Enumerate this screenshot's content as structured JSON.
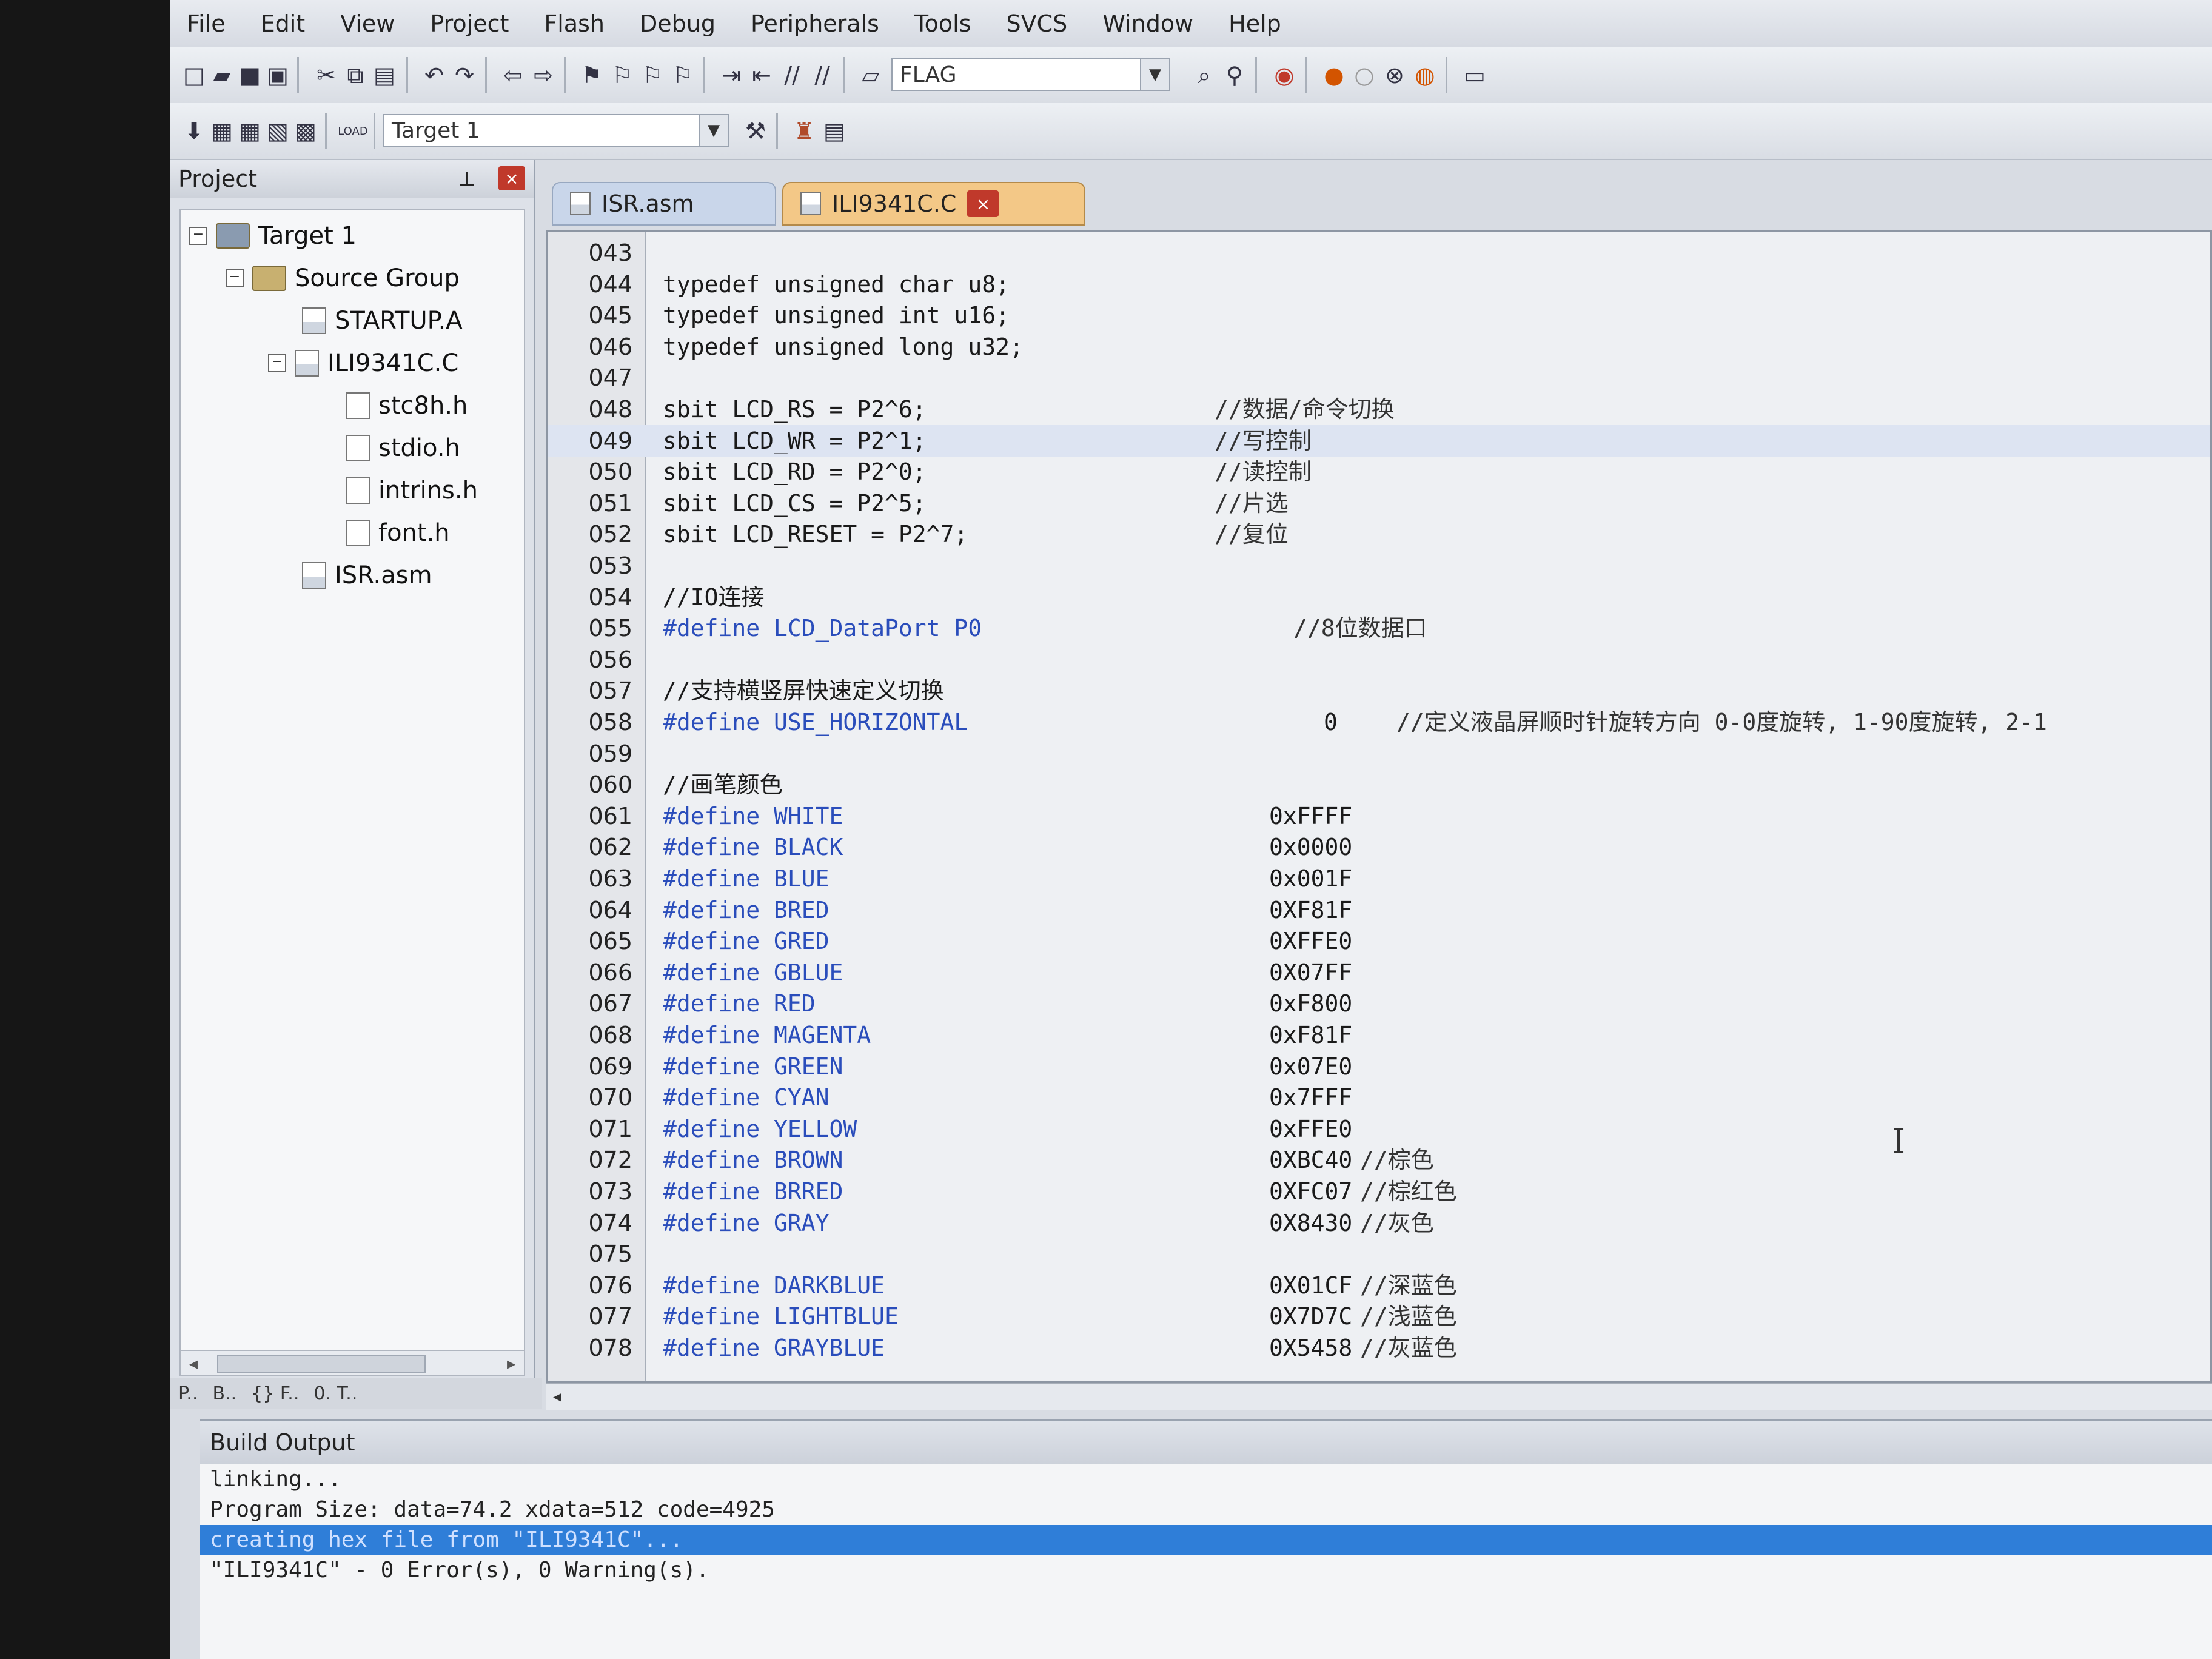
{
  "menu": [
    "File",
    "Edit",
    "View",
    "Project",
    "Flash",
    "Debug",
    "Peripherals",
    "Tools",
    "SVCS",
    "Window",
    "Help"
  ],
  "toolbar": {
    "flag_combo": "FLAG",
    "target_combo": "Target 1",
    "load_label": "LOAD"
  },
  "project": {
    "title": "Project",
    "target": "Target 1",
    "group": "Source Group",
    "files": [
      "STARTUP.A",
      "ILI9341C.C",
      "stc8h.h",
      "stdio.h",
      "intrins.h",
      "font.h",
      "ISR.asm"
    ],
    "tabs": [
      "P..",
      "B..",
      "{} F..",
      "0. T.."
    ]
  },
  "editor": {
    "tabs": [
      "ISR.asm",
      "ILI9341C.C"
    ],
    "lines": [
      {
        "n": "043",
        "code": "",
        "comment": "",
        "value": ""
      },
      {
        "n": "044",
        "code": "typedef     unsigned char   u8;",
        "comment": "",
        "value": ""
      },
      {
        "n": "045",
        "code": "typedef     unsigned int    u16;",
        "comment": "",
        "value": ""
      },
      {
        "n": "046",
        "code": "typedef     unsigned long   u32;",
        "comment": "",
        "value": ""
      },
      {
        "n": "047",
        "code": "",
        "comment": "",
        "value": ""
      },
      {
        "n": "048",
        "code": "sbit LCD_RS = P2^6;",
        "comment": "//数据/命令切换",
        "value": ""
      },
      {
        "n": "049",
        "code": "sbit LCD_WR = P2^1;",
        "comment": "//写控制",
        "value": ""
      },
      {
        "n": "050",
        "code": "sbit LCD_RD = P2^0;",
        "comment": "//读控制",
        "value": ""
      },
      {
        "n": "051",
        "code": "sbit LCD_CS = P2^5;",
        "comment": "//片选",
        "value": ""
      },
      {
        "n": "052",
        "code": "sbit LCD_RESET = P2^7;",
        "comment": "//复位",
        "value": ""
      },
      {
        "n": "053",
        "code": "",
        "comment": "",
        "value": ""
      },
      {
        "n": "054",
        "code": "//IO连接",
        "comment": "",
        "value": ""
      },
      {
        "n": "055",
        "code": "#define  LCD_DataPort P0",
        "comment": "//8位数据口",
        "value": ""
      },
      {
        "n": "056",
        "code": "",
        "comment": "",
        "value": ""
      },
      {
        "n": "057",
        "code": "//支持横竖屏快速定义切换",
        "comment": "",
        "value": ""
      },
      {
        "n": "058",
        "code": "#define USE_HORIZONTAL",
        "comment": "//定义液晶屏顺时针旋转方向     0-0度旋转, 1-90度旋转, 2-1",
        "value": "0"
      },
      {
        "n": "059",
        "code": "",
        "comment": "",
        "value": ""
      },
      {
        "n": "060",
        "code": "//画笔颜色",
        "comment": "",
        "value": ""
      },
      {
        "n": "061",
        "code": "#define WHITE",
        "comment": "",
        "value": "0xFFFF"
      },
      {
        "n": "062",
        "code": "#define BLACK",
        "comment": "",
        "value": "0x0000"
      },
      {
        "n": "063",
        "code": "#define BLUE",
        "comment": "",
        "value": "0x001F"
      },
      {
        "n": "064",
        "code": "#define BRED",
        "comment": "",
        "value": "0XF81F"
      },
      {
        "n": "065",
        "code": "#define GRED",
        "comment": "",
        "value": "0XFFE0"
      },
      {
        "n": "066",
        "code": "#define GBLUE",
        "comment": "",
        "value": "0X07FF"
      },
      {
        "n": "067",
        "code": "#define RED",
        "comment": "",
        "value": "0xF800"
      },
      {
        "n": "068",
        "code": "#define MAGENTA",
        "comment": "",
        "value": "0xF81F"
      },
      {
        "n": "069",
        "code": "#define GREEN",
        "comment": "",
        "value": "0x07E0"
      },
      {
        "n": "070",
        "code": "#define CYAN",
        "comment": "",
        "value": "0x7FFF"
      },
      {
        "n": "071",
        "code": "#define YELLOW",
        "comment": "",
        "value": "0xFFE0"
      },
      {
        "n": "072",
        "code": "#define BROWN",
        "comment": "//棕色",
        "value": "0XBC40"
      },
      {
        "n": "073",
        "code": "#define BRRED",
        "comment": "//棕红色",
        "value": "0XFC07"
      },
      {
        "n": "074",
        "code": "#define GRAY",
        "comment": "//灰色",
        "value": "0X8430"
      },
      {
        "n": "075",
        "code": "",
        "comment": "",
        "value": ""
      },
      {
        "n": "076",
        "code": "#define DARKBLUE",
        "comment": "//深蓝色",
        "value": "0X01CF"
      },
      {
        "n": "077",
        "code": "#define LIGHTBLUE",
        "comment": "//浅蓝色",
        "value": "0X7D7C"
      },
      {
        "n": "078",
        "code": "#define GRAYBLUE",
        "comment": "//灰蓝色",
        "value": "0X5458"
      }
    ]
  },
  "build": {
    "title": "Build Output",
    "lines": [
      "linking...",
      "Program Size: data=74.2 xdata=512 code=4925",
      "creating hex file from \"ILI9341C\"...",
      "\"ILI9341C\" - 0 Error(s), 0 Warning(s)."
    ]
  },
  "colors": {
    "selection": "#2f7ed8",
    "define": "#2a4dbb",
    "active_tab": "#f3c887"
  }
}
